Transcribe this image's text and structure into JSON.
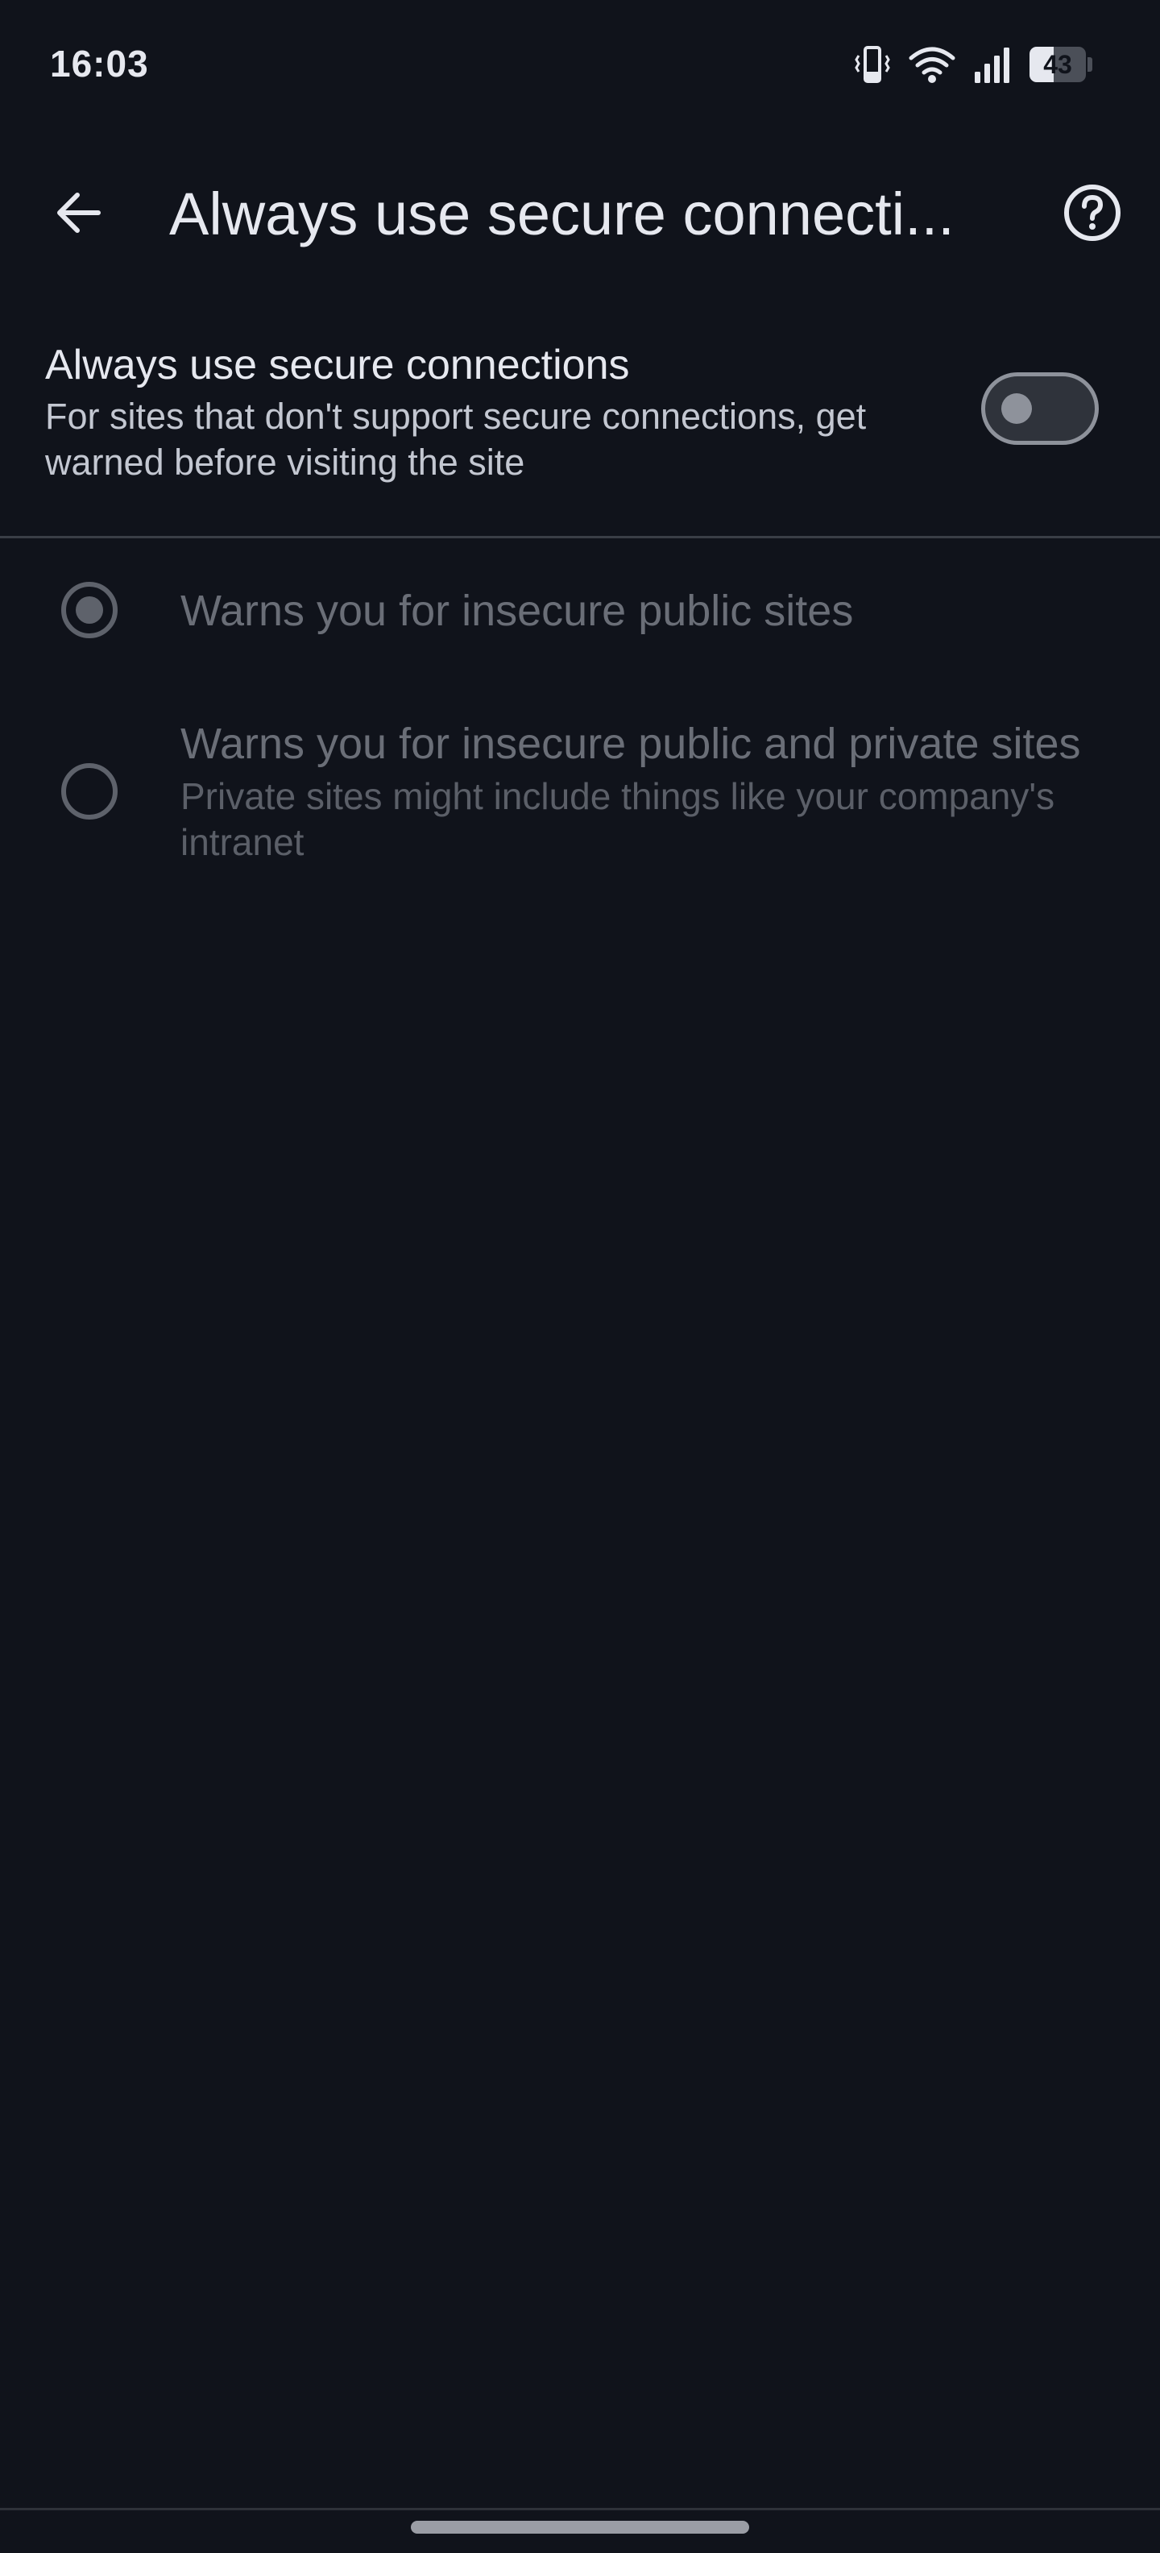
{
  "status_bar": {
    "time": "16:03",
    "icons": [
      "vibrate-icon",
      "wifi-icon",
      "signal-icon",
      "battery-icon"
    ],
    "battery_level": "43",
    "battery_fraction": 0.43
  },
  "app_bar": {
    "title": "Always use secure connecti...",
    "back_icon": "arrow-back-icon",
    "help_icon": "help-icon"
  },
  "main_setting": {
    "title": "Always use secure connections",
    "summary": "For sites that don't support secure connections, get warned before visiting the site",
    "enabled": false
  },
  "options": [
    {
      "label": "Warns you for insecure public sites",
      "summary": "",
      "selected": true,
      "enabled": false
    },
    {
      "label": "Warns you for insecure public and private sites",
      "summary": "Private sites might include things like your company's intranet",
      "selected": false,
      "enabled": false
    }
  ],
  "colors": {
    "background": "#10131b",
    "text_primary": "#e6e8ef",
    "text_secondary": "#c3c7d1",
    "text_disabled": "#6a6e77",
    "toggle_outline": "#8e929b"
  }
}
